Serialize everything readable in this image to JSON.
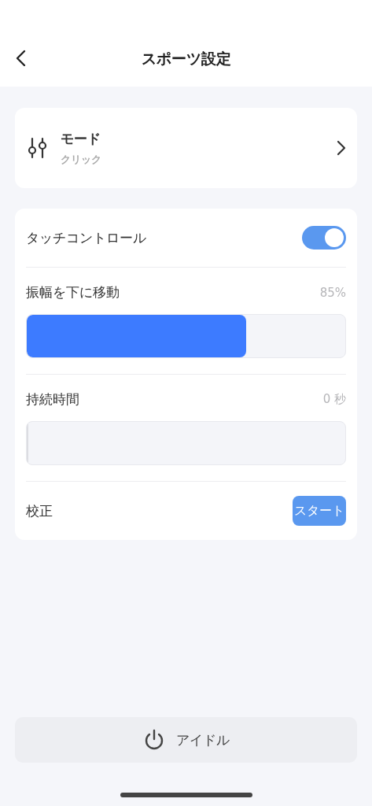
{
  "header": {
    "title": "スポーツ設定"
  },
  "mode": {
    "title": "モード",
    "value": "クリック"
  },
  "settings": [
    {
      "kind": "toggle",
      "label": "タッチコントロール",
      "on": true
    },
    {
      "kind": "slider",
      "label": "振幅を下に移動",
      "reading": "85%",
      "level": 0.69
    },
    {
      "kind": "slider",
      "label": "持続時間",
      "reading": "0 秒",
      "level": 0
    },
    {
      "kind": "action",
      "label": "校正",
      "button": "スタート"
    }
  ],
  "idle_button": {
    "label": "アイドル"
  }
}
